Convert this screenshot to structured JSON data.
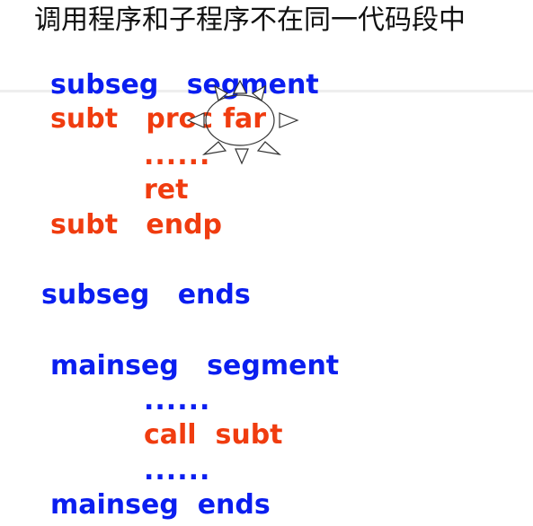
{
  "title": "调用程序和子程序不在同一代码段中",
  "subseg_segment": "subseg   segment",
  "subt_proc": "subt   proc",
  "far": "far",
  "dots1": "......",
  "ret": "ret",
  "subt_endp": "subt   endp",
  "subseg_ends": "subseg   ends",
  "mainseg_segment": "mainseg   segment",
  "dots2": "......",
  "call_subt": "call  subt",
  "dots3": "......",
  "mainseg_ends": "mainseg  ends",
  "colors": {
    "blue": "#0a1ef0",
    "red": "#f03c0f",
    "text": "#111111"
  }
}
